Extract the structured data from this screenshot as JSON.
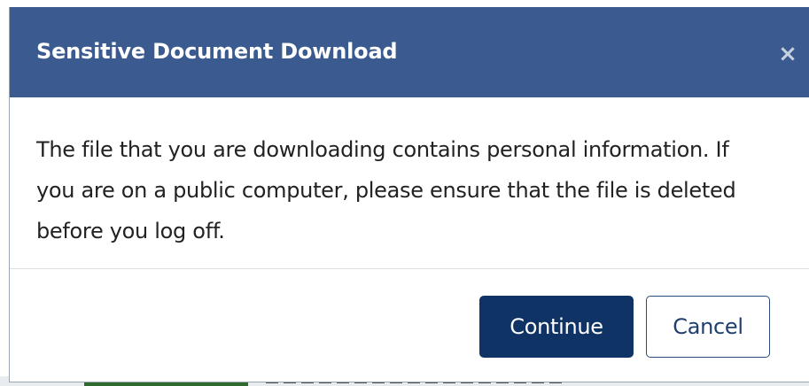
{
  "dialog": {
    "title": "Sensitive Document Download",
    "close_symbol": "×",
    "message": "The file that you are downloading contains personal information. If you are on a public computer, please ensure that the file is deleted before you log off.",
    "buttons": {
      "continue_label": "Continue",
      "cancel_label": "Cancel"
    }
  },
  "colors": {
    "header_bg": "#3b5a8f",
    "primary_button": "#0f3364",
    "secondary_border": "#2a4a7a",
    "text": "#222222"
  },
  "icons": {
    "close": "close-icon"
  }
}
